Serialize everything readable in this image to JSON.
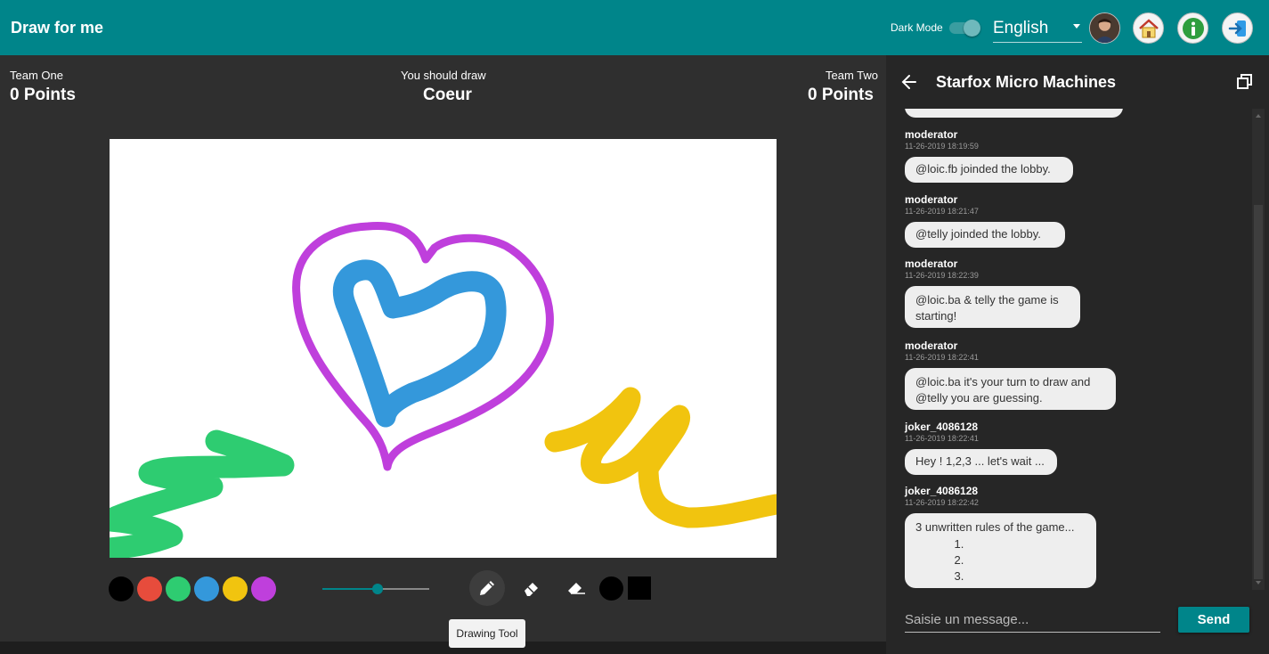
{
  "header": {
    "title": "Draw for me",
    "dark_mode_label": "Dark Mode",
    "dark_mode_on": true,
    "language": "English"
  },
  "game": {
    "team_one": {
      "label": "Team One",
      "points": "0  Points"
    },
    "prompt_label": "You should draw",
    "word": "Coeur",
    "team_two": {
      "label": "Team Two",
      "points": "0  Points"
    }
  },
  "palette": [
    "#000000",
    "#e74c3c",
    "#2ecc71",
    "#3498db",
    "#f1c40f",
    "#bf3fdc"
  ],
  "brush_size_fraction": 0.52,
  "tooltip": "Drawing Tool",
  "chat": {
    "lobby_name": "Starfox Micro Machines",
    "messages": [
      {
        "author": "moderator",
        "time": "11-26-2019 18:19:59",
        "lines": [
          "@loic.fb joinded the lobby."
        ]
      },
      {
        "author": "moderator",
        "time": "11-26-2019 18:21:47",
        "lines": [
          "@telly joinded the lobby."
        ]
      },
      {
        "author": "moderator",
        "time": "11-26-2019 18:22:39",
        "lines": [
          "@loic.ba & telly the game is",
          "starting!"
        ]
      },
      {
        "author": "moderator",
        "time": "11-26-2019 18:22:41",
        "lines": [
          "@loic.ba it's your turn to draw and",
          "@telly you are guessing."
        ]
      },
      {
        "author": "joker_4086128",
        "time": "11-26-2019 18:22:41",
        "lines": [
          "Hey ! 1,2,3 ... let's wait ..."
        ]
      },
      {
        "author": "joker_4086128",
        "time": "11-26-2019 18:22:42",
        "lines": [
          "3 unwritten rules of the game..."
        ],
        "list_items": 3
      }
    ],
    "input_placeholder": "Saisie un message...",
    "send_label": "Send"
  }
}
